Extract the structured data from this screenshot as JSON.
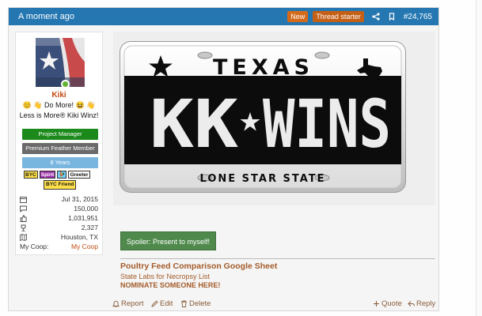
{
  "header": {
    "time": "A moment ago",
    "badge_new": "New",
    "badge_starter": "Thread starter",
    "post_number": "#24,765",
    "icons": [
      "share-icon",
      "bookmark-icon"
    ]
  },
  "user": {
    "name": "Kiki",
    "title_line1": "😊 👋 Do More! 😆 👋",
    "title_line2": "Less is More® Kiki Winz!",
    "banners": [
      "Project Manager",
      "Premium Feather Member",
      "8 Years"
    ],
    "mini_badges": [
      "BYC",
      "Spirit",
      "🐓",
      "Greeter"
    ],
    "friend_badge": "BYC Friend",
    "stats": [
      {
        "icon": "calendar-icon",
        "value": "Jul 31, 2015"
      },
      {
        "icon": "messages-icon",
        "value": "150,000"
      },
      {
        "icon": "thumbs-up-icon",
        "value": "1,031,951"
      },
      {
        "icon": "trophy-icon",
        "value": "2,327"
      },
      {
        "icon": "map-icon",
        "value": "Houston, TX"
      }
    ],
    "coop_label": "My Coop:",
    "coop_value": "My Coop"
  },
  "plate": {
    "state": "TEXAS",
    "number_left": "KK",
    "number_right": "WINS",
    "motto": "LONE STAR STATE"
  },
  "spoiler": "Spoiler: Present to myself!",
  "signature": {
    "line1": "Poultry Feed Comparison Google Sheet",
    "line2": "State Labs for Necropsy List",
    "line3": "NOMINATE SOMEONE HERE!"
  },
  "actions": {
    "report": "Report",
    "edit": "Edit",
    "delete": "Delete",
    "quote": "Quote",
    "reply": "Reply"
  },
  "colors": {
    "header_bg": "#2577b1",
    "username": "#c24a0e",
    "signature": "#a45b2a",
    "spoiler_bg": "#4f8a4c"
  }
}
